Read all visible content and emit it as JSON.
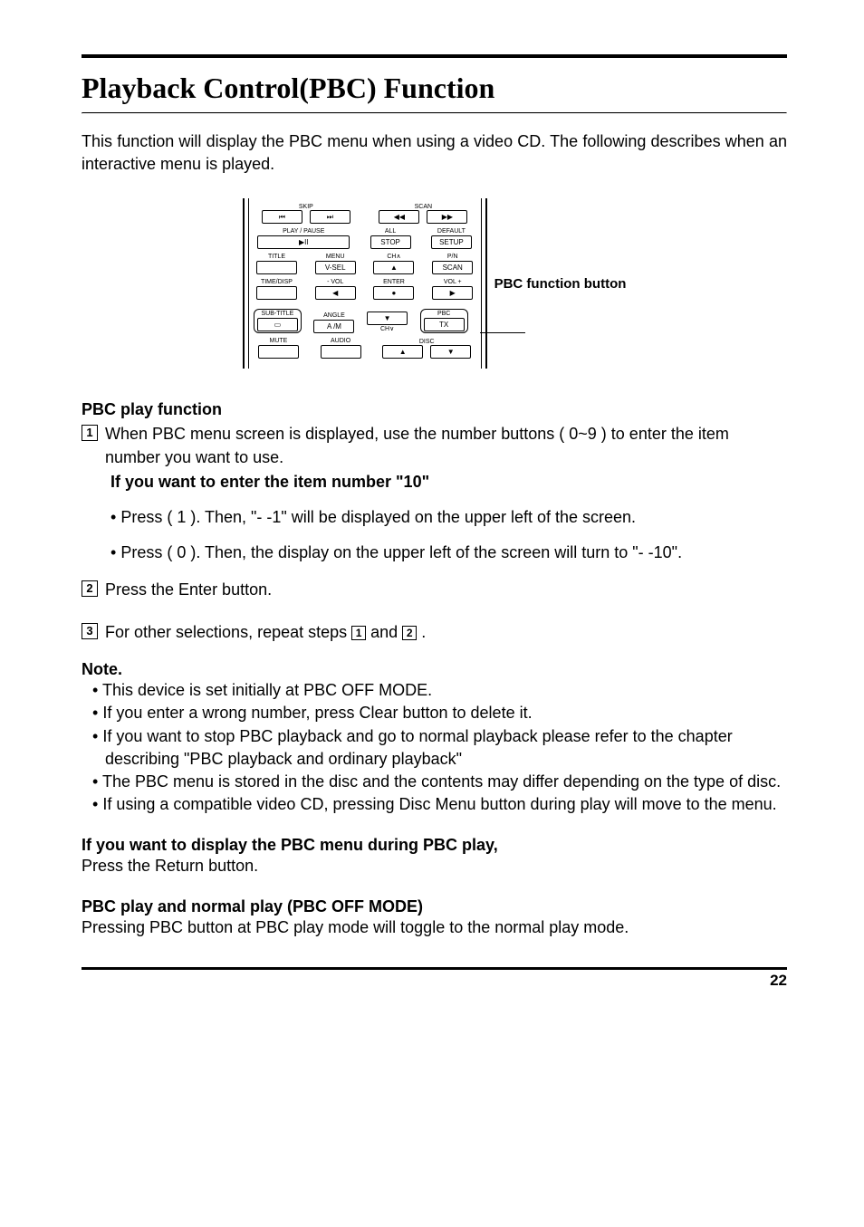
{
  "title": "Playback Control(PBC) Function",
  "intro": "This function will display the PBC menu when using a video CD. The following describes when an interactive menu is played.",
  "remote": {
    "skip_label": "SKIP",
    "scan_label": "SCAN",
    "skip_prev": "⏮",
    "skip_next": "⏭",
    "scan_rev": "◀◀",
    "scan_fwd": "▶▶",
    "play_pause_label": "PLAY / PAUSE",
    "play_pause": "▶II",
    "all": "ALL",
    "stop": "STOP",
    "default": "DEFAULT",
    "setup": "SETUP",
    "title": "TITLE",
    "menu": "MENU",
    "vsel": "V-SEL",
    "ch_up": "CH∧",
    "up": "▲",
    "pn": "P/N",
    "scan": "SCAN",
    "time_disp": "TIME/DISP",
    "vol_minus": "- VOL",
    "left": "◀",
    "enter": "ENTER",
    "dot": "●",
    "vol_plus": "VOL +",
    "right": "▶",
    "subtitle": "SUB-TITLE",
    "subtitle_icon": "▭",
    "angle": "ANGLE",
    "am": "A /M",
    "ch_down": "CH∨",
    "down": "▼",
    "pbc": "PBC",
    "tx": "TX",
    "mute": "MUTE",
    "audio": "AUDIO",
    "disc": "DISC",
    "disc_up": "▲",
    "disc_down": "▼"
  },
  "callout": "PBC function button",
  "pbc_play_heading": "PBC play function",
  "step1_text": "When PBC menu screen is displayed, use the number buttons ( 0~9 ) to enter the item number you want to use.",
  "step1_bold": "If you want to enter the item number \"10\"",
  "step1_bullet1": "Press ( 1 ). Then, \"- -1\" will be displayed on the upper left of the screen.",
  "step1_bullet2": "Press ( 0 ). Then, the display on the upper left of the screen will turn to \"- -10\".",
  "step2_text": "Press the Enter button.",
  "step3_prefix": "For other selections, repeat steps ",
  "step3_mid": " and ",
  "step3_suffix": " .",
  "num1": "1",
  "num2": "2",
  "num3": "3",
  "note_heading": "Note.",
  "notes": {
    "n1": "This device is set initially at PBC OFF MODE.",
    "n2": "If you enter a wrong number, press Clear button to delete it.",
    "n3": "If you want to stop PBC playback and go to normal playback please refer to the chapter describing \"PBC playback and ordinary playback\"",
    "n4": "The PBC menu is stored in the disc and the contents may differ depending on the type of disc.",
    "n5": "If using a compatible video CD, pressing Disc Menu button during play will move to the menu."
  },
  "display_heading": "If you want to display the PBC menu during PBC play,",
  "display_text": "Press the Return button.",
  "mode_heading": "PBC play and normal play (PBC OFF MODE)",
  "mode_text": "Pressing PBC button at PBC play mode will toggle to the normal play mode.",
  "page_number": "22"
}
